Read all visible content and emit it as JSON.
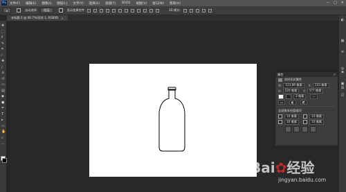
{
  "app": {
    "logo_text": "Ps",
    "menu": [
      "文件(F)",
      "编辑(E)",
      "图像(I)",
      "图层(L)",
      "文字(Y)",
      "选择(S)",
      "滤镜(T)",
      "3D(D)",
      "视图(V)",
      "窗口(W)",
      "帮助(H)"
    ],
    "window_controls": [
      "—",
      "□",
      "✕"
    ]
  },
  "options": {
    "tool_preset": "▸",
    "auto_select_label": "自动选择:",
    "auto_select_value": "图层",
    "show_transform_label": "显示变换控件",
    "mode_3d_label": "3D 模式:"
  },
  "doc_tabs": [
    {
      "label": "未标题-1 @ 66.7%(形状 1, RGB/8)",
      "close": "×"
    }
  ],
  "tools": [
    {
      "name": "move-tool",
      "glyph": "✥"
    },
    {
      "name": "marquee-tool",
      "glyph": "⬚"
    },
    {
      "name": "lasso-tool",
      "glyph": "ℓ"
    },
    {
      "name": "quick-select-tool",
      "glyph": "✎"
    },
    {
      "name": "crop-tool",
      "glyph": "⌗"
    },
    {
      "name": "eyedropper-tool",
      "glyph": "⁄"
    },
    {
      "name": "healing-brush-tool",
      "glyph": "✚"
    },
    {
      "name": "brush-tool",
      "glyph": "∕"
    },
    {
      "name": "clone-stamp-tool",
      "glyph": "♙"
    },
    {
      "name": "history-brush-tool",
      "glyph": "↺"
    },
    {
      "name": "eraser-tool",
      "glyph": "▭"
    },
    {
      "name": "gradient-tool",
      "glyph": "▤"
    },
    {
      "name": "blur-tool",
      "glyph": "◆"
    },
    {
      "name": "dodge-tool",
      "glyph": "●"
    },
    {
      "name": "pen-tool",
      "glyph": "✒"
    },
    {
      "name": "type-tool",
      "glyph": "T"
    },
    {
      "name": "path-select-tool",
      "glyph": "▸"
    },
    {
      "name": "shape-tool",
      "glyph": "▭"
    },
    {
      "name": "hand-tool",
      "glyph": "✋"
    },
    {
      "name": "zoom-tool",
      "glyph": "⌕"
    },
    {
      "name": "more-tools",
      "glyph": "…"
    }
  ],
  "dock": [
    "◐",
    "▦",
    "≡",
    "◎",
    "⚑",
    "▣",
    "⊞",
    "◫"
  ],
  "properties_panel": {
    "title": "属性",
    "subtitle": "实时形状属性",
    "w_label": "W:",
    "w_value": "123.89 像素",
    "h_label": "H:",
    "h_value": "220 像素",
    "x_label": "X:",
    "x_value": "233 像素",
    "y_label": "Y:",
    "y_value": "177 像素",
    "stroke_width": "3 像素",
    "corner_label": "0 像素",
    "link_label": "全部角半径值相同",
    "radius_1": "10 像素",
    "radius_2": "10 像素",
    "radius_3": "10 像素",
    "radius_4": "10 像素"
  },
  "watermark": {
    "brand_prefix": "Bai",
    "brand_mid": "du",
    "brand_suffix": "经验",
    "url": "jingyan.baidu.com"
  },
  "colors": {
    "menubar": "#535353",
    "workspace": "#282828",
    "canvas": "#ffffff",
    "bottle_stroke": "#000000"
  }
}
